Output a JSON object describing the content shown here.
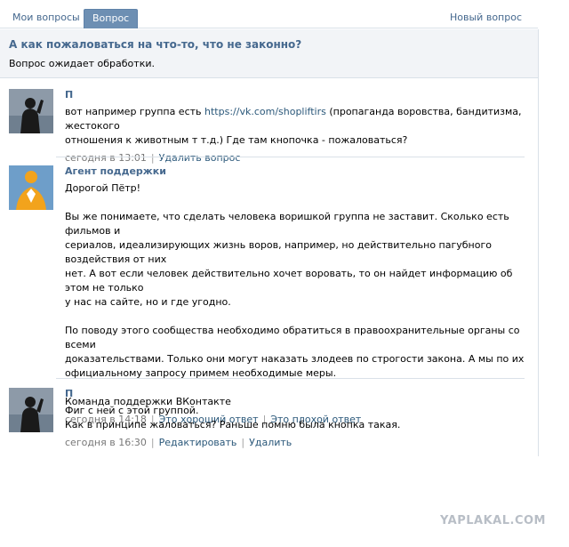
{
  "tabs": {
    "my_questions": "Мои вопросы",
    "question": "Вопрос",
    "new_question": "Новый вопрос"
  },
  "question": {
    "title": "А как пожаловаться на что-то, что не законно?",
    "status": "Вопрос ожидает обработки."
  },
  "posts": [
    {
      "author": "П",
      "lines": {
        "l1_before": "вот например группа есть ",
        "l1_link": "https://vk.com/shopliftirs",
        "l1_after": " (пропаганда воровства, бандитизма, жестокого",
        "l2": "отношения к животным т т.д.) Где там кнопочка - пожаловаться?"
      },
      "time": "сегодня в 13:01",
      "actions": [
        "Удалить вопрос"
      ]
    },
    {
      "author": "Агент поддержки",
      "lines": {
        "l1": "Дорогой Пётр!",
        "l2": "Вы же понимаете, что сделать человека воришкой группа не заставит. Сколько есть фильмов и",
        "l3": "сериалов, идеализирующих жизнь воров, например, но действительно пагубного воздействия от них",
        "l4": "нет. А вот если человек действительно хочет воровать, то он найдет информацию об этом не только",
        "l5": "у нас на сайте, но и где угодно.",
        "l6": "По поводу этого сообщества необходимо обратиться в правоохранительные органы со всеми",
        "l7": "доказательствами. Только они могут наказать злодеев по строгости закона. А мы по их",
        "l8": "официальному запросу примем необходимые меры.",
        "l9": "Команда поддержки ВКонтакте"
      },
      "time": "сегодня в 14:18",
      "actions": [
        "Это хороший ответ",
        "Это плохой ответ"
      ]
    },
    {
      "author": "П",
      "lines": {
        "l1": "Фиг с ней с этой группой.",
        "l2": "Как в принципе жаловаться? Раньше помню была кнопка такая."
      },
      "time": "сегодня в 16:30",
      "actions": [
        "Редактировать",
        "Удалить"
      ]
    }
  ],
  "watermark": "YAPLAKAL.COM",
  "colors": {
    "link": "#2b587a",
    "author": "#45688e",
    "tab_active_bg": "#6d8fb3",
    "header_bg": "#f2f4f7",
    "agent_avatar_bg": "#6e9ec9",
    "agent_figure": "#f2a31c"
  },
  "icons": {
    "user_avatar": "silhouette-avatar-icon",
    "agent_avatar": "support-agent-avatar-icon"
  }
}
